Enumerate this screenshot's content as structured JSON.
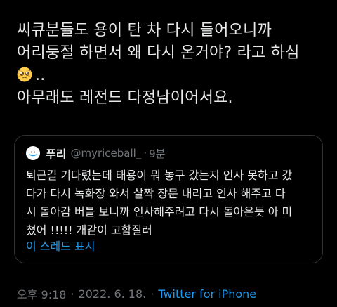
{
  "tweet": {
    "lines": [
      "씨큐분들도 용이 탄 차 다시 들어오니까",
      "어리둥절 하면서 왜 다시 온거야? 라고 하심",
      "..",
      "아무래도 레전드 다정남이어서요."
    ],
    "emoji_name": "pleading-face"
  },
  "quoted": {
    "name": "푸리",
    "handle": "@myriceball_",
    "dot": "·",
    "time": "9분",
    "lines": [
      "퇴근길 기다렸는데 태용이 뭐 놓구 갔는지 인사 못하고 갔",
      "다가 다시 녹화장 와서 살짝 장문 내리고 인사 해주고 다",
      "시 돌아감 버블 보니까 인사해주려고 다시 돌아온듯 아 미",
      "쳤어 !!!!! 개같이 고함질러"
    ],
    "show_thread": "이 스레드 표시"
  },
  "meta": {
    "time": "오후 9:18",
    "sep": "·",
    "date": "2022. 6. 18.",
    "sep2": "·",
    "source": "Twitter for iPhone"
  }
}
